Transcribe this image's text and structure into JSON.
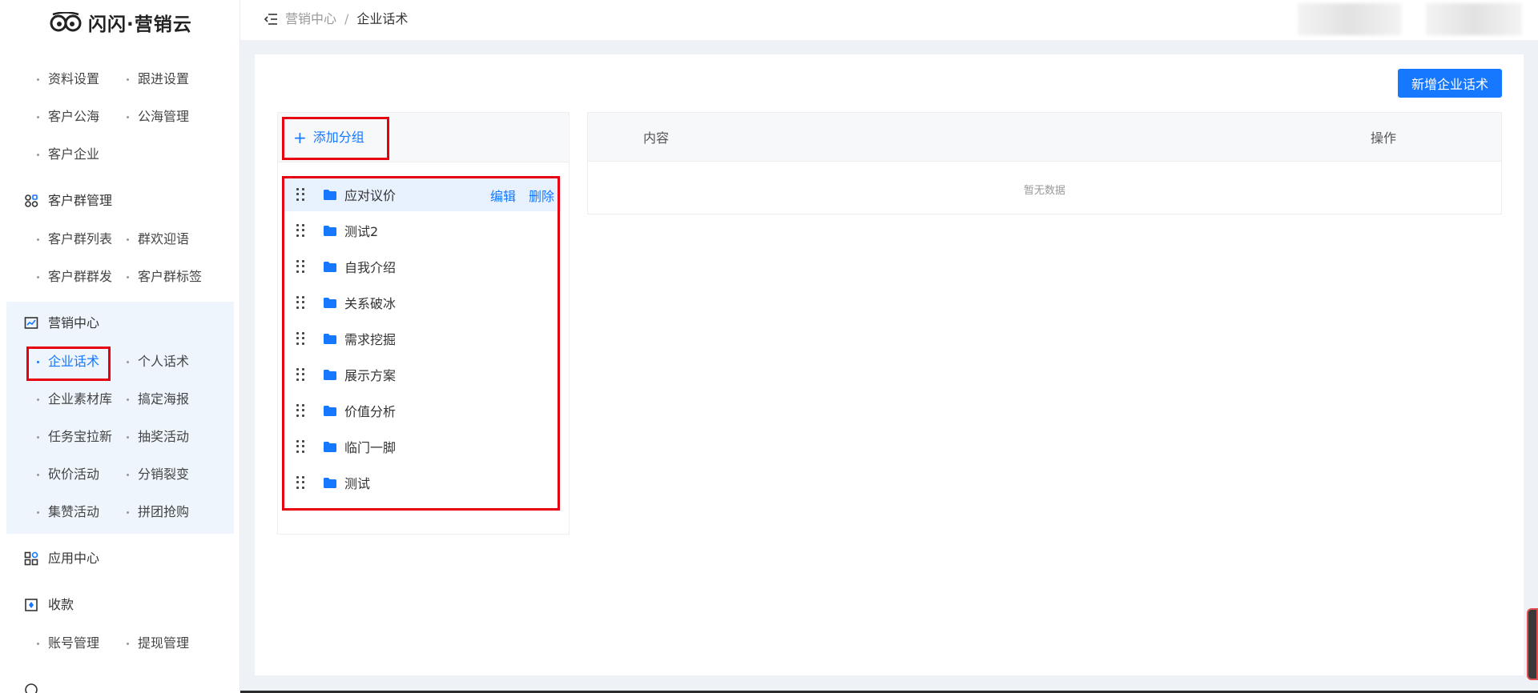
{
  "app": {
    "logo_text": "闪闪·营销云"
  },
  "sidebar": {
    "top_items": [
      {
        "label": "资料设置"
      },
      {
        "label": "跟进设置"
      },
      {
        "label": "客户公海"
      },
      {
        "label": "公海管理"
      },
      {
        "label": "客户企业"
      }
    ],
    "groups": [
      {
        "title": "客户群管理",
        "icon": "group-icon",
        "items": [
          {
            "label": "客户群列表"
          },
          {
            "label": "群欢迎语"
          },
          {
            "label": "客户群群发"
          },
          {
            "label": "客户群标签"
          }
        ]
      },
      {
        "title": "营销中心",
        "icon": "chart-icon",
        "items": [
          {
            "label": "企业话术",
            "active": true
          },
          {
            "label": "个人话术"
          },
          {
            "label": "企业素材库"
          },
          {
            "label": "搞定海报"
          },
          {
            "label": "任务宝拉新"
          },
          {
            "label": "抽奖活动"
          },
          {
            "label": "砍价活动"
          },
          {
            "label": "分销裂变"
          },
          {
            "label": "集赞活动"
          },
          {
            "label": "拼团抢购"
          }
        ]
      },
      {
        "title": "应用中心",
        "icon": "apps-icon",
        "items": []
      },
      {
        "title": "收款",
        "icon": "wallet-icon",
        "items": [
          {
            "label": "账号管理"
          },
          {
            "label": "提现管理"
          }
        ]
      }
    ]
  },
  "header": {
    "breadcrumb_parent": "营销中心",
    "breadcrumb_sep": "/",
    "breadcrumb_current": "企业话术"
  },
  "main": {
    "add_button_label": "新增企业话术",
    "add_group_label": "添加分组",
    "group_list": [
      {
        "label": "应对议价",
        "hover": true
      },
      {
        "label": "测试2"
      },
      {
        "label": "自我介绍"
      },
      {
        "label": "关系破冰"
      },
      {
        "label": "需求挖掘"
      },
      {
        "label": "展示方案"
      },
      {
        "label": "价值分析"
      },
      {
        "label": "临门一脚"
      },
      {
        "label": "测试"
      }
    ],
    "row_actions": {
      "edit": "编辑",
      "delete": "删除"
    },
    "table": {
      "columns": [
        "内容",
        "操作"
      ],
      "empty_text": "暂无数据"
    }
  },
  "colors": {
    "primary": "#1677ff",
    "highlight": "#e60012",
    "active_group_bg": "#eef5fd"
  }
}
